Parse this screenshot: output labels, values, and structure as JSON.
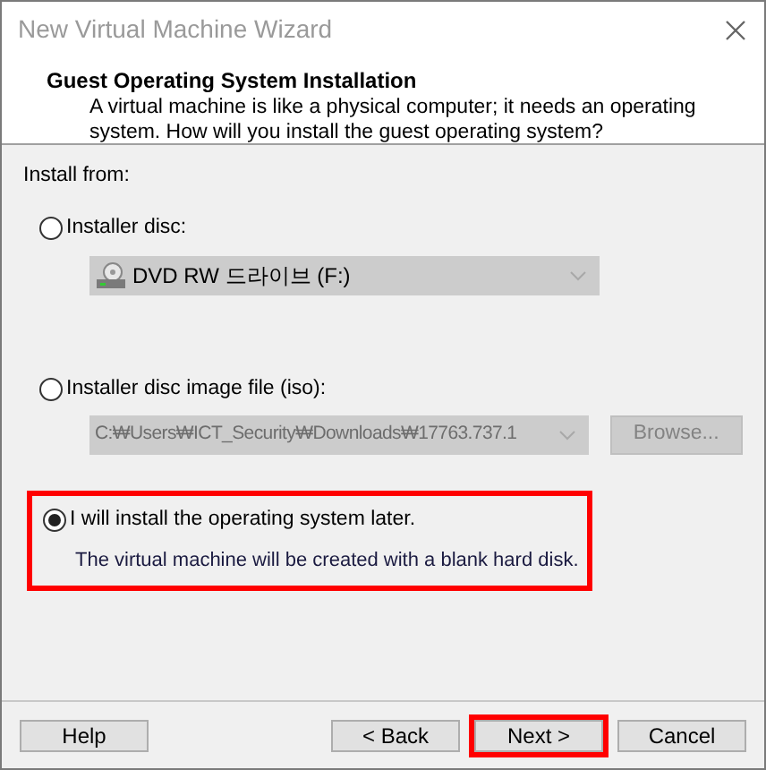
{
  "window": {
    "title": "New Virtual Machine Wizard"
  },
  "header": {
    "title": "Guest Operating System Installation",
    "description": "A virtual machine is like a physical computer; it needs an operating system. How will you install the guest operating system?"
  },
  "group_label": "Install from:",
  "options": [
    {
      "kind": "dropdown",
      "label": "Installer disc:",
      "selected": false,
      "highlighted": false,
      "field": {
        "value": "DVD RW 드라이브 (F:)",
        "disabled": true
      }
    },
    {
      "kind": "file",
      "label": "Installer disc image file (iso):",
      "selected": false,
      "highlighted": false,
      "field": {
        "value": "C:₩Users₩ICT_Security₩Downloads₩17763.737.1",
        "disabled": true
      },
      "browse": {
        "label": "Browse...",
        "disabled": true
      }
    },
    {
      "kind": "later",
      "label": "I will install the operating system later.",
      "selected": true,
      "highlighted": true,
      "note": "The virtual machine will be created with a blank hard disk."
    }
  ],
  "buttons": [
    {
      "label": "Help",
      "highlighted": false
    },
    {
      "label": "< Back",
      "highlighted": false
    },
    {
      "label": "Next >",
      "highlighted": true
    },
    {
      "label": "Cancel",
      "highlighted": false
    }
  ]
}
